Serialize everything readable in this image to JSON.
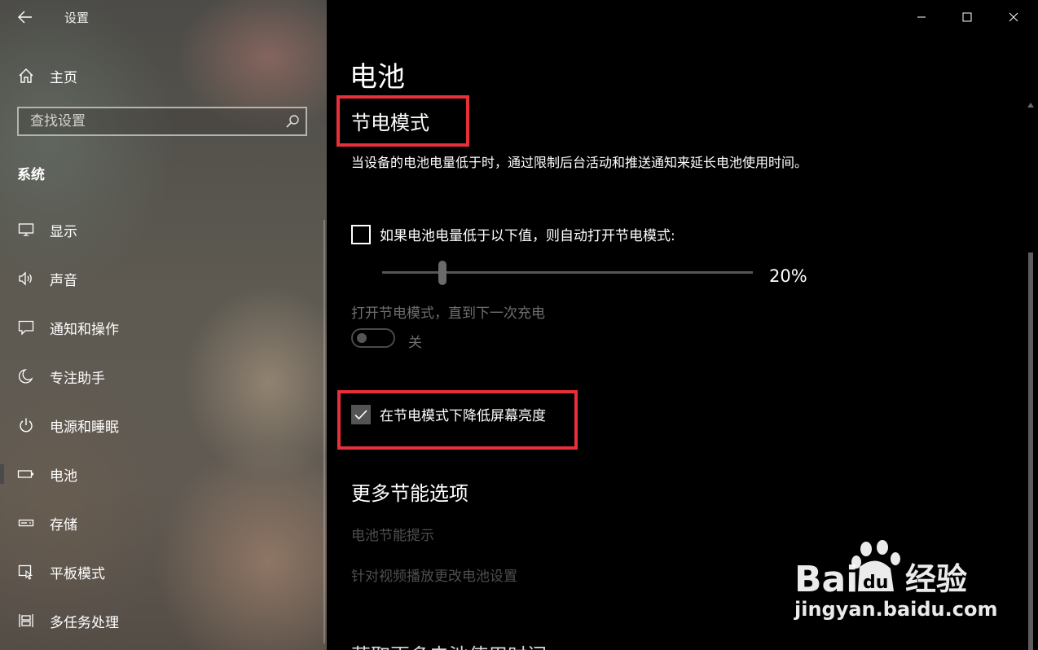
{
  "window": {
    "app_title": "设置"
  },
  "sidebar": {
    "home_label": "主页",
    "search_placeholder": "查找设置",
    "section_header": "系统",
    "items": [
      {
        "label": "显示",
        "icon": "display-icon"
      },
      {
        "label": "声音",
        "icon": "speaker-icon"
      },
      {
        "label": "通知和操作",
        "icon": "notification-icon"
      },
      {
        "label": "专注助手",
        "icon": "moon-icon"
      },
      {
        "label": "电源和睡眠",
        "icon": "power-icon"
      },
      {
        "label": "电池",
        "icon": "battery-icon",
        "selected": true
      },
      {
        "label": "存储",
        "icon": "storage-icon"
      },
      {
        "label": "平板模式",
        "icon": "tablet-icon"
      },
      {
        "label": "多任务处理",
        "icon": "multitask-icon"
      }
    ]
  },
  "main": {
    "page_title": "电池",
    "battery_saver": {
      "heading": "节电模式",
      "description": "当设备的电池电量低于时，通过限制后台活动和推送通知来延长电池使用时间。",
      "auto_checkbox_label": "如果电池电量低于以下值，则自动打开节电模式:",
      "auto_checkbox_checked": false,
      "slider_value_label": "20%",
      "slider_value": 20,
      "until_charge_label": "打开节电模式，直到下一次充电",
      "toggle_state_label": "关",
      "toggle_on": false,
      "dim_checkbox_label": "在节电模式下降低屏幕亮度",
      "dim_checkbox_checked": true
    },
    "more_options": {
      "heading": "更多节能选项",
      "links": [
        "电池节能提示",
        "针对视频播放更改电池设置"
      ]
    },
    "partial_heading": "获取更多电池使用时间"
  },
  "annotations": {
    "highlight_color": "#e8303a"
  },
  "watermark": {
    "brand": "Bai 经验",
    "url": "jingyan.baidu.com"
  }
}
